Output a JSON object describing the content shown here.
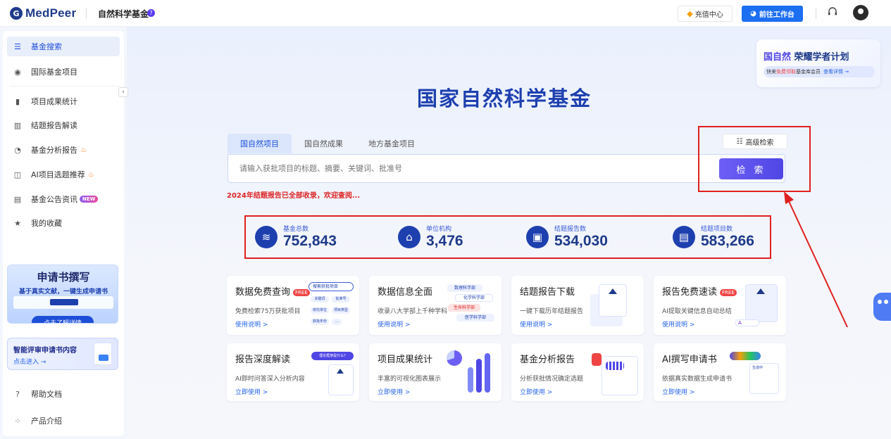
{
  "topbar": {
    "logo_mark": "G",
    "logo_text": "MedPeer",
    "site_name": "自然科学基金",
    "help_badge": "?",
    "recharge_label": "充值中心",
    "workspace_label": "前往工作台",
    "icons": {
      "recharge": "diamond-icon",
      "workspace": "logo-icon",
      "support": "headset-icon",
      "avatar": "user-avatar-icon"
    }
  },
  "sidebar": {
    "items": [
      {
        "label": "基金搜索",
        "icon": "search-list-icon"
      },
      {
        "label": "国际基金项目",
        "icon": "globe-icon"
      },
      {
        "label": "项目成果统计",
        "icon": "bar-chart-icon"
      },
      {
        "label": "结题报告解读",
        "icon": "chart-sparkle-icon"
      },
      {
        "label": "基金分析报告",
        "icon": "pie-chart-icon"
      },
      {
        "label": "AI项目选题推荐",
        "icon": "ai-topic-icon"
      },
      {
        "label": "基金公告资讯",
        "icon": "news-icon"
      },
      {
        "label": "我的收藏",
        "icon": "star-icon"
      },
      {
        "label": "帮助文档",
        "icon": "help-doc-icon"
      },
      {
        "label": "产品介绍",
        "icon": "product-intro-icon"
      }
    ],
    "new_badge": "NEW",
    "promo_write": {
      "title": "申请书撰写",
      "subtitle": "基于真实文献，一键生成申请书",
      "cta": "点击了解详情"
    },
    "promo_review": {
      "title": "智能评审申请书内容",
      "link": "点击进入 →"
    }
  },
  "hero": {
    "title": "国家自然科学基金"
  },
  "search": {
    "tabs": [
      "国自然项目",
      "国自然成果",
      "地方基金项目"
    ],
    "advanced_label": "高级检索",
    "placeholder": "请输入获批项目的标题、摘要、关键词、批准号",
    "button_label": "检 索",
    "notice": "2024年结题报告已全部收录，欢迎查阅..."
  },
  "stats": [
    {
      "label": "基金总数",
      "value": "752,843",
      "icon": "database-icon"
    },
    {
      "label": "单位机构",
      "value": "3,476",
      "icon": "institution-icon"
    },
    {
      "label": "结题报告数",
      "value": "534,030",
      "icon": "report-icon"
    },
    {
      "label": "结题项目数",
      "value": "583,266",
      "icon": "project-icon"
    }
  ],
  "cards": [
    {
      "title": "数据免费查询",
      "badge": "FREE",
      "desc": "免费检索75万获批项目",
      "link": "使用说明 >"
    },
    {
      "title": "数据信息全面",
      "badge": "",
      "desc": "收录八大学部上千种学科",
      "link": "使用说明 >"
    },
    {
      "title": "结题报告下载",
      "badge": "",
      "desc": "一键下载历年结题报告",
      "link": "使用说明 >"
    },
    {
      "title": "报告免费速读",
      "badge": "FREE",
      "desc": "AI提取关键信息自动总结",
      "link": "使用说明 >"
    },
    {
      "title": "报告深度解读",
      "badge": "",
      "desc": "AI即时问答深入分析内容",
      "link": "立即使用 >"
    },
    {
      "title": "项目成果统计",
      "badge": "",
      "desc": "丰富的可视化图表展示",
      "link": "立即使用 >"
    },
    {
      "title": "基金分析报告",
      "badge": "",
      "desc": "分析获批情况确定选题",
      "link": "立即使用 >"
    },
    {
      "title": "AI撰写申请书",
      "badge": "",
      "desc": "依据真实数据生成申请书",
      "link": "立即使用 >"
    }
  ],
  "card_illus": {
    "search_pill": "搜索获批项目",
    "tags1": [
      "关键词",
      "批准号",
      "依托单位",
      "项目类型",
      "获批年份",
      "…"
    ],
    "depts": [
      "数理科学部",
      "化学科学部",
      "生命科学部",
      "医学科学部"
    ],
    "qa_bubble": "理论框架是什么?",
    "generating": "生成中"
  },
  "honor": {
    "title_a": "国自然",
    "title_b": " 荣耀学者计划",
    "line_pre": "快来",
    "line_free": "免费领取",
    "line_mid": "基金库会员",
    "line_link": "查看详情 →"
  },
  "colors": {
    "brand": "#1e40af",
    "accent": "#4f46e5",
    "alert": "#dc2626",
    "highlight_box": "#e02020"
  }
}
